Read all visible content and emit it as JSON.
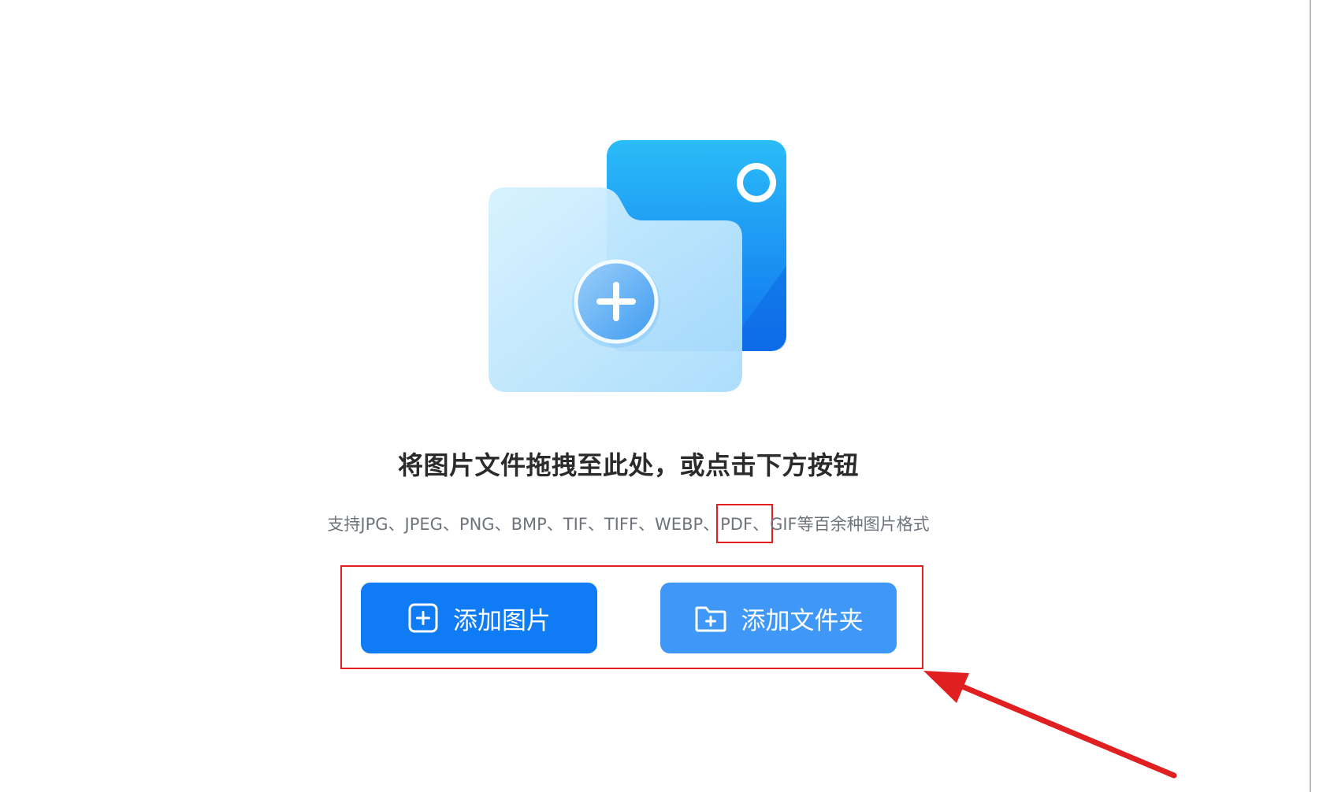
{
  "upload": {
    "headline": "将图片文件拖拽至此处，或点击下方按钮",
    "formats_before": "支持JPG、JPEG、PNG、BMP、TIF、TIFF、WEBP、",
    "formats_highlight": "PDF、",
    "formats_after": "GIF等百余种图片格式"
  },
  "buttons": {
    "add_images": "添加图片",
    "add_folder": "添加文件夹"
  },
  "icons": {
    "illustration": "folder-image-plus-icon",
    "add_images": "plus-square-icon",
    "add_folder": "folder-plus-icon",
    "annotation": "red-arrow-icon"
  },
  "colors": {
    "primary_button": "#0f7cf5",
    "secondary_button": "#3f98f8",
    "annotation_red": "#e02020"
  }
}
